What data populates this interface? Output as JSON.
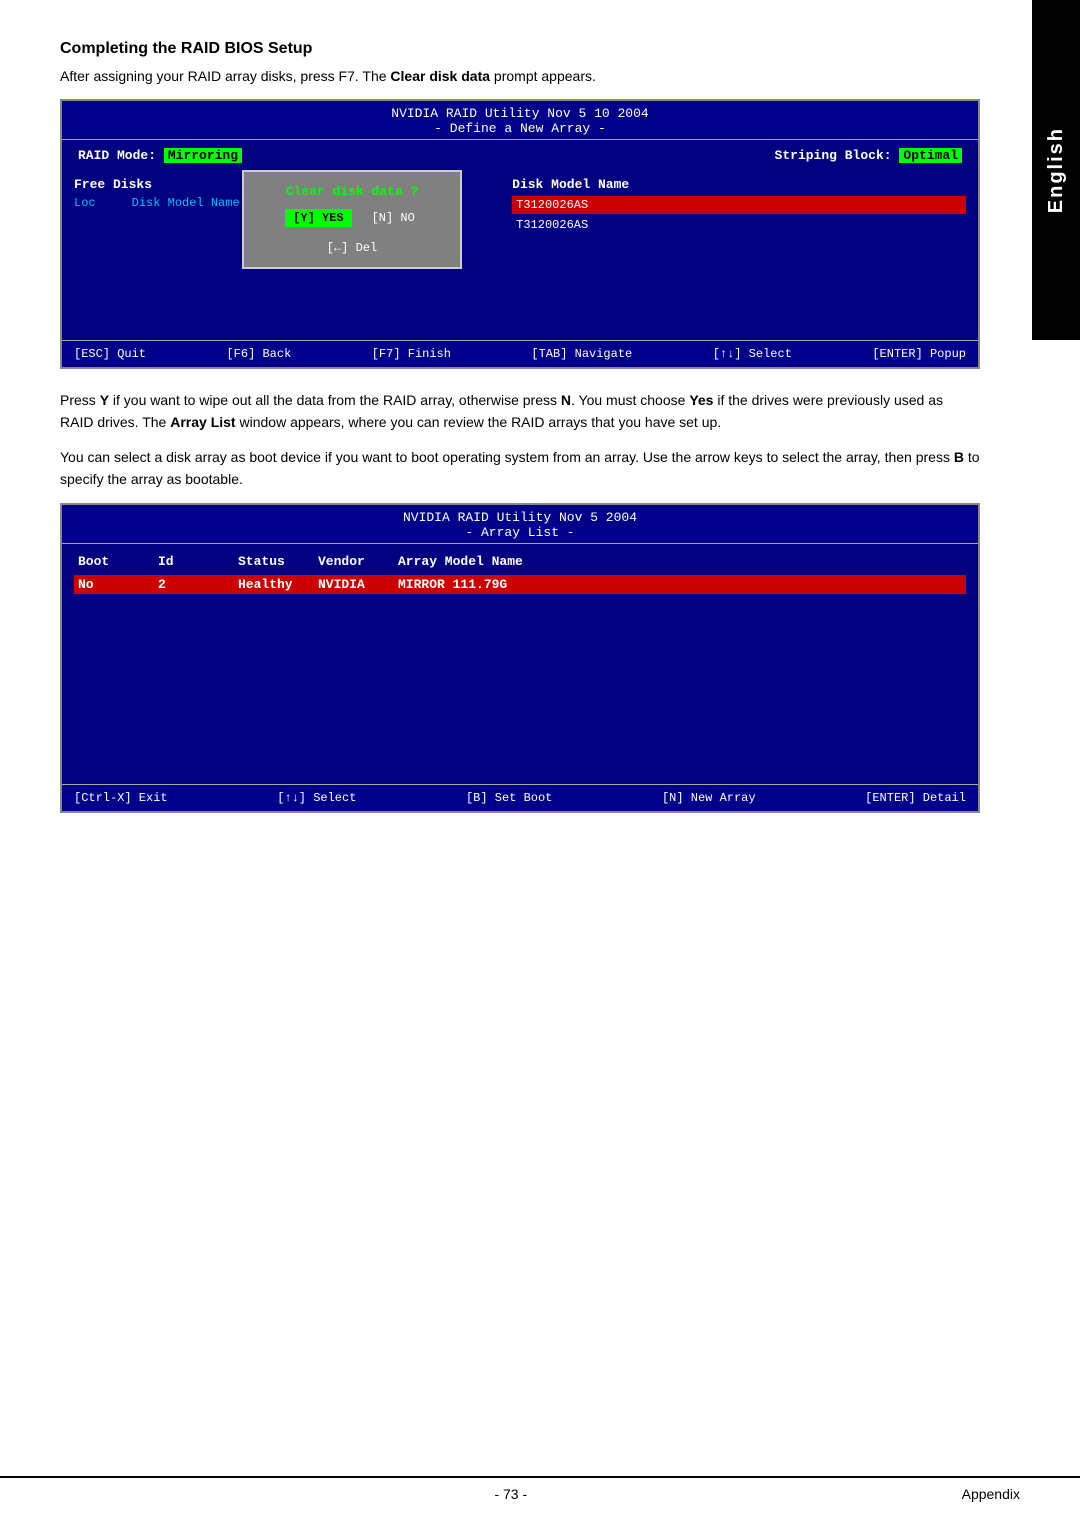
{
  "english_tab": "English",
  "section": {
    "heading": "Completing the RAID BIOS Setup",
    "intro": "After assigning your RAID array disks, press F7. The Clear disk data prompt appears."
  },
  "bios1": {
    "title_line1": "NVIDIA RAID Utility  Nov 5 10 2004",
    "title_line2": "- Define a New Array -",
    "raid_mode_label": "RAID Mode:",
    "raid_mode_value": "Mirroring",
    "striping_label": "Striping Block:",
    "striping_value": "Optimal",
    "free_disks_label": "Free Disks",
    "loc_label": "Loc",
    "disk_model_label": "Disk Model Name",
    "dialog_title": "Clear disk data ?",
    "dialog_yes": "[Y] YES",
    "dialog_no": "[N] NO",
    "dialog_del": "[←] Del",
    "disk_right_label": "Disk Model Name",
    "disk_row1": "T3120026AS",
    "disk_row2": "T3120026AS",
    "footer": {
      "esc": "[ESC] Quit",
      "f6": "[F6] Back",
      "f7": "[F7] Finish",
      "tab": "[TAB] Navigate",
      "select": "[↑↓] Select",
      "enter": "[ENTER] Popup"
    }
  },
  "para1": "Press Y if you want to wipe out all the data from the RAID array, otherwise press N. You must choose Yes if the drives were previously used as RAID drives. The Array List window appears, where you can review the RAID arrays that you have set up.",
  "para2": "You can select a disk array as boot device if you want to boot operating system from an array. Use the arrow keys to select the array, then press B to specify the array as bootable.",
  "bios2": {
    "title_line1": "NVIDIA RAID Utility  Nov 5 2004",
    "title_line2": "- Array List -",
    "col_boot": "Boot",
    "col_id": "Id",
    "col_status": "Status",
    "col_vendor": "Vendor",
    "col_array": "Array Model Name",
    "row1_boot": "No",
    "row1_id": "2",
    "row1_status": "Healthy",
    "row1_vendor": "NVIDIA",
    "row1_array": "MIRROR  111.79G",
    "footer": {
      "ctrlx": "[Ctrl-X] Exit",
      "select": "[↑↓] Select",
      "boot": "[B] Set Boot",
      "new": "[N] New Array",
      "detail": "[ENTER] Detail"
    }
  },
  "page_number": "- 73 -",
  "appendix": "Appendix"
}
